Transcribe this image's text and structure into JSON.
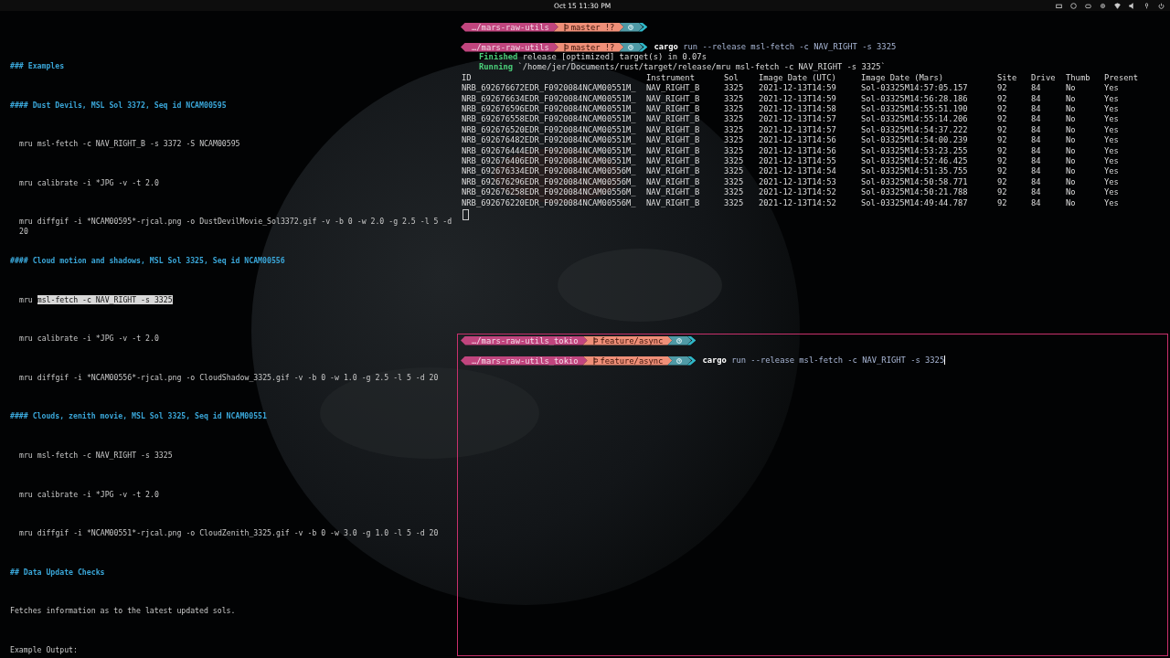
{
  "top_bar": {
    "datetime": "Oct 15  11:30 PM"
  },
  "editor": {
    "lines": [
      {
        "kind": "heading",
        "text": "### Examples"
      },
      {
        "kind": "heading",
        "text": "#### Dust Devils, MSL Sol 3372, Seq id NCAM00595"
      },
      {
        "kind": "code",
        "text": "mru msl-fetch -c NAV_RIGHT_B -s 3372 -S NCAM00595"
      },
      {
        "kind": "code",
        "text": "mru calibrate -i *JPG -v -t 2.0"
      },
      {
        "kind": "code",
        "text": "mru diffgif -i *NCAM00595*-rjcal.png -o DustDevilMovie_Sol3372.gif -v -b 0 -w 2.0 -g 2.5 -l 5 -d 20"
      },
      {
        "kind": "heading",
        "text": "#### Cloud motion and shadows, MSL Sol 3325, Seq id NCAM00556"
      },
      {
        "kind": "code",
        "text": "mru ",
        "selection": "msl-fetch -c NAV_RIGHT -s 3325"
      },
      {
        "kind": "code",
        "text": "mru calibrate -i *JPG -v -t 2.0"
      },
      {
        "kind": "code",
        "text": "mru diffgif -i *NCAM00556*-rjcal.png -o CloudShadow_3325.gif -v -b 0 -w 1.0 -g 2.5 -l 5 -d 20"
      },
      {
        "kind": "heading",
        "text": "#### Clouds, zenith movie, MSL Sol 3325, Seq id NCAM00551"
      },
      {
        "kind": "code",
        "text": "mru msl-fetch -c NAV_RIGHT -s 3325"
      },
      {
        "kind": "code",
        "text": "mru calibrate -i *JPG -v -t 2.0"
      },
      {
        "kind": "code",
        "text": "mru diffgif -i *NCAM00551*-rjcal.png -o CloudZenith_3325.gif -v -b 0 -w 3.0 -g 1.0 -l 5 -d 20"
      },
      {
        "kind": "heading",
        "text": "## Data Update Checks"
      },
      {
        "kind": "text",
        "text": "Fetches information as to the latest updated sols."
      },
      {
        "kind": "text",
        "text": "Example Output:"
      }
    ]
  },
  "terminals": [
    {
      "focused": false,
      "prompts": [
        {
          "path": "…/mars-raw-utils",
          "branch": "master !?"
        },
        {
          "path": "…/mars-raw-utils",
          "branch": "master !?",
          "program": "cargo",
          "args": "run --release msl-fetch -c NAV_RIGHT -s 3325"
        }
      ],
      "output": [
        {
          "label": "Finished",
          "text": "release [optimized] target(s) in 0.07s"
        },
        {
          "label": "Running",
          "text": "`/home/jer/Documents/rust/target/release/mru msl-fetch -c NAV_RIGHT -s 3325`"
        }
      ],
      "table": {
        "columns": [
          "ID",
          "Instrument",
          "Sol",
          "Image Date (UTC)",
          "Image Date (Mars)",
          "Site",
          "Drive",
          "Thumb",
          "Present"
        ],
        "rows": [
          [
            "NRB_692676672EDR_F0920084NCAM00551M_",
            "NAV_RIGHT_B",
            "3325",
            "2021-12-13T14:59",
            "Sol-03325M14:57:05.157",
            "92",
            "84",
            "No",
            "Yes"
          ],
          [
            "NRB_692676634EDR_F0920084NCAM00551M_",
            "NAV_RIGHT_B",
            "3325",
            "2021-12-13T14:59",
            "Sol-03325M14:56:28.186",
            "92",
            "84",
            "No",
            "Yes"
          ],
          [
            "NRB_692676596EDR_F0920084NCAM00551M_",
            "NAV_RIGHT_B",
            "3325",
            "2021-12-13T14:58",
            "Sol-03325M14:55:51.190",
            "92",
            "84",
            "No",
            "Yes"
          ],
          [
            "NRB_692676558EDR_F0920084NCAM00551M_",
            "NAV_RIGHT_B",
            "3325",
            "2021-12-13T14:57",
            "Sol-03325M14:55:14.206",
            "92",
            "84",
            "No",
            "Yes"
          ],
          [
            "NRB_692676520EDR_F0920084NCAM00551M_",
            "NAV_RIGHT_B",
            "3325",
            "2021-12-13T14:57",
            "Sol-03325M14:54:37.222",
            "92",
            "84",
            "No",
            "Yes"
          ],
          [
            "NRB_692676482EDR_F0920084NCAM00551M_",
            "NAV_RIGHT_B",
            "3325",
            "2021-12-13T14:56",
            "Sol-03325M14:54:00.239",
            "92",
            "84",
            "No",
            "Yes"
          ],
          [
            "NRB_692676444EDR_F0920084NCAM00551M_",
            "NAV_RIGHT_B",
            "3325",
            "2021-12-13T14:56",
            "Sol-03325M14:53:23.255",
            "92",
            "84",
            "No",
            "Yes"
          ],
          [
            "NRB_692676406EDR_F0920084NCAM00551M_",
            "NAV_RIGHT_B",
            "3325",
            "2021-12-13T14:55",
            "Sol-03325M14:52:46.425",
            "92",
            "84",
            "No",
            "Yes"
          ],
          [
            "NRB_692676334EDR_F0920084NCAM00556M_",
            "NAV_RIGHT_B",
            "3325",
            "2021-12-13T14:54",
            "Sol-03325M14:51:35.755",
            "92",
            "84",
            "No",
            "Yes"
          ],
          [
            "NRB_692676296EDR_F0920084NCAM00556M_",
            "NAV_RIGHT_B",
            "3325",
            "2021-12-13T14:53",
            "Sol-03325M14:50:58.771",
            "92",
            "84",
            "No",
            "Yes"
          ],
          [
            "NRB_692676258EDR_F0920084NCAM00556M_",
            "NAV_RIGHT_B",
            "3325",
            "2021-12-13T14:52",
            "Sol-03325M14:50:21.788",
            "92",
            "84",
            "No",
            "Yes"
          ],
          [
            "NRB_692676220EDR_F0920084NCAM00556M_",
            "NAV_RIGHT_B",
            "3325",
            "2021-12-13T14:52",
            "Sol-03325M14:49:44.787",
            "92",
            "84",
            "No",
            "Yes"
          ]
        ]
      },
      "cursor_line": true
    },
    {
      "focused": true,
      "prompts": [
        {
          "path": "…/mars-raw-utils_tokio",
          "branch": "feature/async"
        },
        {
          "path": "…/mars-raw-utils_tokio",
          "branch": "feature/async",
          "program": "cargo",
          "args": "run --release msl-fetch -c NAV_RIGHT -s 3325"
        }
      ]
    }
  ]
}
